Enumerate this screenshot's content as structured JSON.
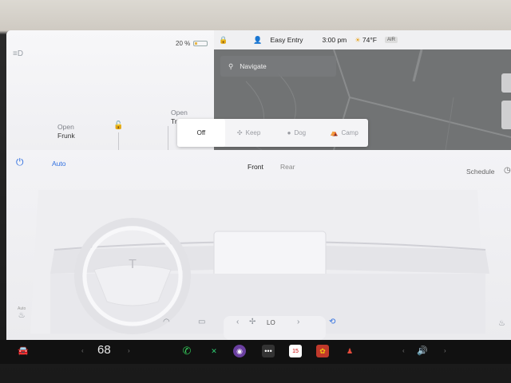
{
  "status": {
    "battery_percent": "20 %",
    "battery_level": 0.2,
    "profile": "Easy Entry",
    "time": "3:00 pm",
    "temperature": "74°F",
    "air_badge": "AIR"
  },
  "car": {
    "frunk_state": "Open",
    "frunk_label": "Frunk",
    "trunk_state": "Open",
    "trunk_label": "Tr"
  },
  "map": {
    "search_placeholder": "Navigate"
  },
  "mode_popup": {
    "options": [
      "Off",
      "Keep",
      "Dog",
      "Camp"
    ],
    "selected": "Off"
  },
  "climate": {
    "auto_label": "Auto",
    "tabs": [
      "Front",
      "Rear"
    ],
    "schedule_label": "Schedule",
    "fan_label": "LO"
  },
  "taskbar": {
    "cabin_temp": "68",
    "icons": [
      "car-icon",
      "phone-icon",
      "app-icon",
      "camera-icon",
      "more-icon",
      "calendar-icon",
      "toybox-icon",
      "arcade-icon",
      "volume-icon"
    ],
    "calendar_day": "15"
  },
  "colors": {
    "accent": "#2f6fe0",
    "map_bg": "#717374",
    "taskbar_bg": "#111111"
  }
}
